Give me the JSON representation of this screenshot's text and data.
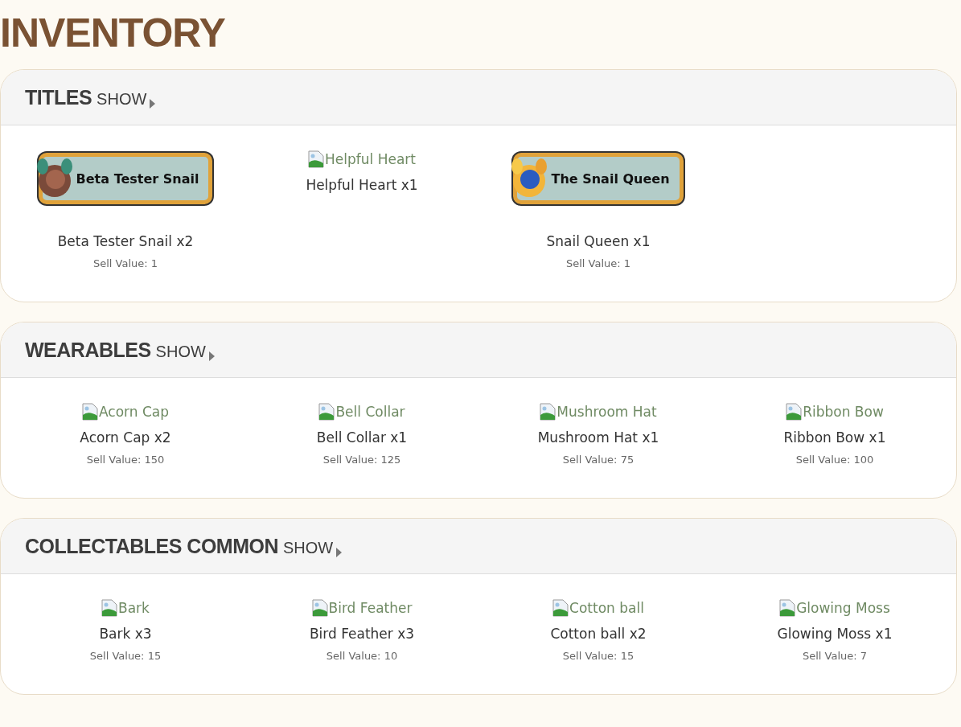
{
  "page_title": "INVENTORY",
  "sections": [
    {
      "title": "TITLES",
      "toggle": "SHOW",
      "items": [
        {
          "kind": "banner",
          "banner_text": "Beta Tester Snail",
          "name": "Beta Tester Snail x2",
          "sell": "Sell Value: 1"
        },
        {
          "kind": "broken",
          "alt": "Helpful Heart",
          "name": "Helpful Heart x1"
        },
        {
          "kind": "banner",
          "banner_text": "The Snail Queen",
          "name": "Snail Queen x1",
          "sell": "Sell Value: 1"
        }
      ]
    },
    {
      "title": "WEARABLES",
      "toggle": "SHOW",
      "items": [
        {
          "kind": "broken",
          "alt": "Acorn Cap",
          "name": "Acorn Cap x2",
          "sell": "Sell Value: 150"
        },
        {
          "kind": "broken",
          "alt": "Bell Collar",
          "name": "Bell Collar x1",
          "sell": "Sell Value: 125"
        },
        {
          "kind": "broken",
          "alt": "Mushroom Hat",
          "name": "Mushroom Hat x1",
          "sell": "Sell Value: 75"
        },
        {
          "kind": "broken",
          "alt": "Ribbon Bow",
          "name": "Ribbon Bow x1",
          "sell": "Sell Value: 100"
        }
      ]
    },
    {
      "title": "COLLECTABLES COMMON",
      "toggle": "SHOW",
      "items": [
        {
          "kind": "broken",
          "alt": "Bark",
          "name": "Bark x3",
          "sell": "Sell Value: 15"
        },
        {
          "kind": "broken",
          "alt": "Bird Feather",
          "name": "Bird Feather x3",
          "sell": "Sell Value: 10"
        },
        {
          "kind": "broken",
          "alt": "Cotton ball",
          "name": "Cotton ball x2",
          "sell": "Sell Value: 15"
        },
        {
          "kind": "broken",
          "alt": "Glowing Moss",
          "name": "Glowing Moss x1",
          "sell": "Sell Value: 7"
        }
      ]
    }
  ]
}
